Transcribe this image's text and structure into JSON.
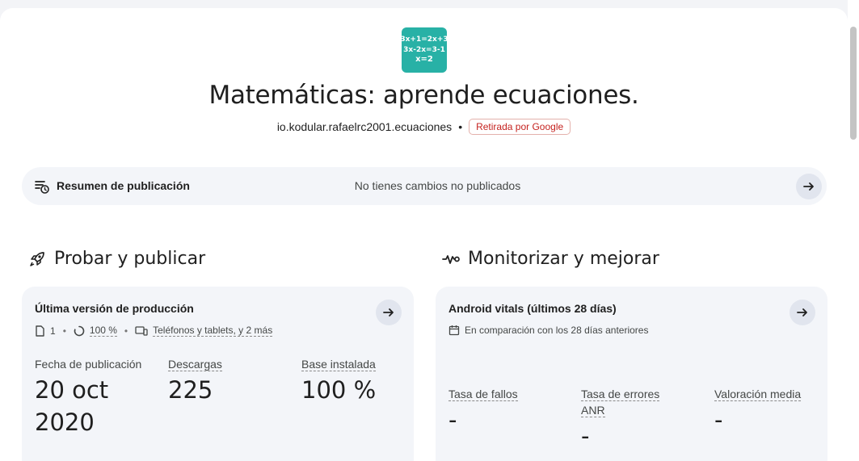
{
  "app": {
    "icon_lines": [
      "3x+1=2x+3",
      "3x-2x=3-1",
      "x=2"
    ],
    "icon_color": "#28b1a6",
    "title": "Matemáticas: aprende ecuaciones.",
    "package": "io.kodular.rafaelrc2001.ecuaciones",
    "status_badge": "Retirada por Google"
  },
  "summary": {
    "icon": "publishing-summary-icon",
    "label": "Resumen de publicación",
    "status": "No tienes cambios no publicados"
  },
  "test_publish": {
    "icon": "rocket-icon",
    "heading": "Probar y publicar",
    "card": {
      "title": "Última versión de producción",
      "bundles": "1",
      "rollout": "100 %",
      "devices": "Teléfonos y tablets, y 2 más",
      "release_date_label": "Fecha de publicación",
      "release_date_line1": "20 oct",
      "release_date_line2": "2020",
      "downloads_label": "Descargas",
      "downloads_value": "225",
      "installed_label": "Base instalada",
      "installed_value": "100 %"
    }
  },
  "monitor": {
    "icon": "vitals-icon",
    "heading": "Monitorizar y mejorar",
    "card": {
      "title": "Android vitals (últimos 28 días)",
      "comparison": "En comparación con los 28 días anteriores",
      "crash_label": "Tasa de fallos",
      "crash_value": "-",
      "anr_label_line1": "Tasa de errores",
      "anr_label_line2": "ANR",
      "anr_value": "-",
      "rating_label": "Valoración media",
      "rating_value": "-"
    }
  }
}
